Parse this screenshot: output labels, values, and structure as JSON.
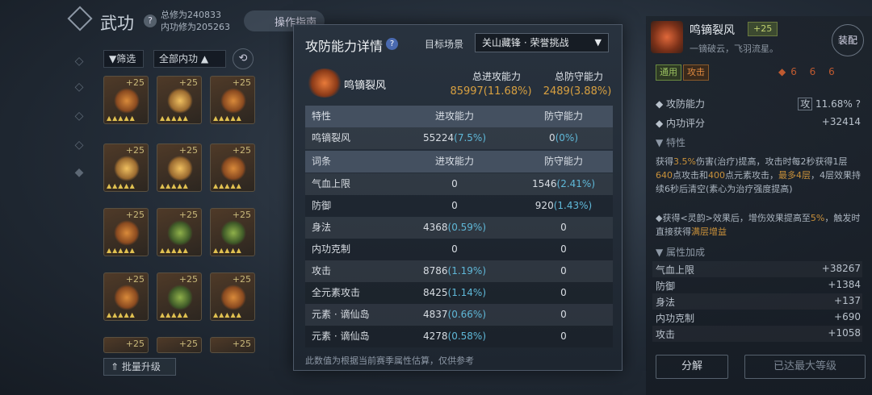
{
  "left": {
    "title": "武功",
    "cultivation_total": "总修为240833",
    "cultivation_inner": "内功修为205263",
    "guide_btn": "操作指南",
    "filter_btn": "筛选",
    "filter_all": "全部内功",
    "level_badge": "+25",
    "bulk_upgrade": "批量升级"
  },
  "dialog": {
    "title": "攻防能力详情",
    "scene_label": "目标场景",
    "scene_value": "关山藏锋 · 荣誉挑战",
    "skill_name": "鸣镝裂风",
    "total_attack_label": "总进攻能力",
    "total_attack_value": "85997(11.68%)",
    "total_defense_label": "总防守能力",
    "total_defense_value": "2489(3.88%)",
    "trait_headers": [
      "特性",
      "进攻能力",
      "防守能力"
    ],
    "trait_rows": [
      {
        "name": "鸣镝裂风",
        "atk": "55224",
        "atk_pct": "(7.5%)",
        "def": "0",
        "def_pct": "(0%)"
      }
    ],
    "entry_headers": [
      "词条",
      "进攻能力",
      "防守能力"
    ],
    "entry_rows": [
      {
        "name": "气血上限",
        "atk": "0",
        "atk_pct": "",
        "def": "1546",
        "def_pct": "(2.41%)"
      },
      {
        "name": "防御",
        "atk": "0",
        "atk_pct": "",
        "def": "920",
        "def_pct": "(1.43%)"
      },
      {
        "name": "身法",
        "atk": "4368",
        "atk_pct": "(0.59%)",
        "def": "0",
        "def_pct": ""
      },
      {
        "name": "内功克制",
        "atk": "0",
        "atk_pct": "",
        "def": "0",
        "def_pct": ""
      },
      {
        "name": "攻击",
        "atk": "8786",
        "atk_pct": "(1.19%)",
        "def": "0",
        "def_pct": ""
      },
      {
        "name": "全元素攻击",
        "atk": "8425",
        "atk_pct": "(1.14%)",
        "def": "0",
        "def_pct": ""
      },
      {
        "name": "元素 · 谪仙岛",
        "atk": "4837",
        "atk_pct": "(0.66%)",
        "def": "0",
        "def_pct": ""
      },
      {
        "name": "元素 · 谪仙岛",
        "atk": "4278",
        "atk_pct": "(0.58%)",
        "def": "0",
        "def_pct": ""
      }
    ],
    "footnote": "此数值为根据当前赛季属性估算，仅供参考"
  },
  "right": {
    "name": "鸣镝裂风",
    "level": "+25",
    "subtitle": "一镝破云，飞羽流星。",
    "equip_btn": "装配",
    "tags": [
      "通用",
      "攻击"
    ],
    "rating_label": "攻防能力",
    "rating_icon": "攻",
    "rating_value": "11.68%",
    "inner_score_label": "内功评分",
    "inner_score_value": "+32414",
    "trait_header": "特性",
    "desc_p1": "获得",
    "desc_h1": "3.5%",
    "desc_p2": "伤害(治疗)提高，攻击时每2秒获得1层",
    "desc_h2": "640",
    "desc_p3": "点攻击和",
    "desc_h3": "400",
    "desc_p4": "点元素攻击，",
    "desc_h4": "最多4层",
    "desc_p5": "，4层效果持续6秒后清空(素心为治疗强度提高)",
    "desc2_p1": "◆获得<灵韵>效果后，增伤效果提高至",
    "desc2_h1": "5%",
    "desc2_p2": "，触发时直接获得",
    "desc2_h2": "满层增益",
    "attr_header": "属性加成",
    "attrs": [
      {
        "name": "气血上限",
        "value": "+38267"
      },
      {
        "name": "防御",
        "value": "+1384"
      },
      {
        "name": "身法",
        "value": "+137"
      },
      {
        "name": "内功克制",
        "value": "+690"
      },
      {
        "name": "攻击",
        "value": "+1058"
      }
    ],
    "decompose_btn": "分解",
    "maxed_btn": "已达最大等级"
  },
  "colors": {
    "accent_gold": "#d8a040",
    "pct_blue": "#5fb8d8"
  }
}
